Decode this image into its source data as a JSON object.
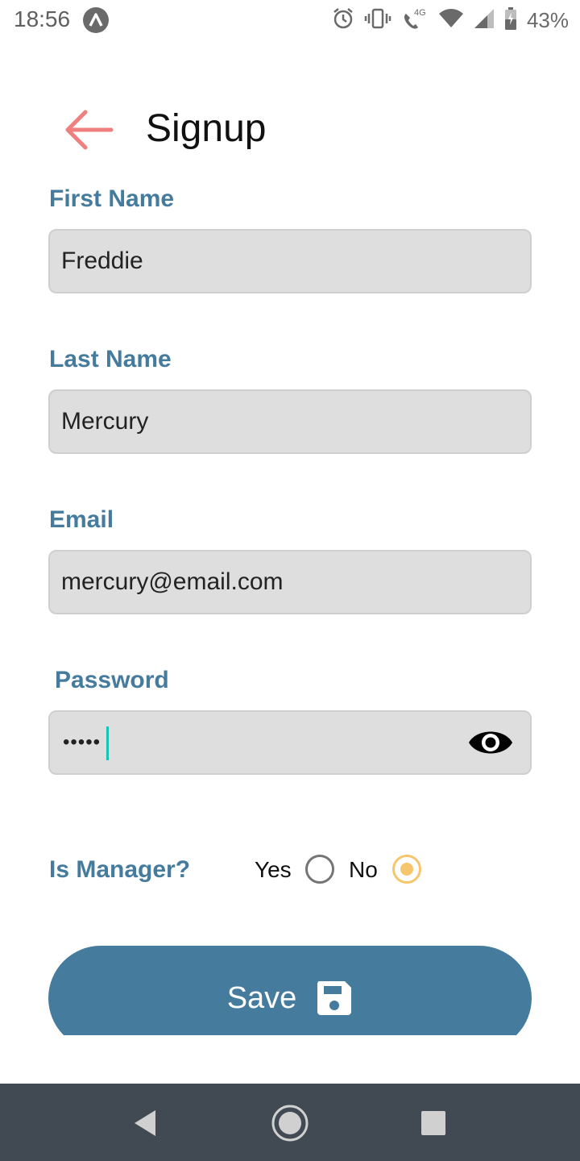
{
  "status_bar": {
    "time": "18:56",
    "app_icon": "lambda-icon",
    "icons": [
      "alarm-icon",
      "vibrate-icon",
      "wifi-calling-4g-icon",
      "wifi-icon",
      "cell-signal-icon",
      "battery-icon"
    ],
    "network_label": "4G",
    "battery_percent": "43%"
  },
  "header": {
    "back_icon": "arrow-left-icon",
    "title": "Signup"
  },
  "form": {
    "first_name": {
      "label": "First Name",
      "value": "Freddie"
    },
    "last_name": {
      "label": "Last Name",
      "value": "Mercury"
    },
    "email": {
      "label": "Email",
      "value": "mercury@email.com"
    },
    "password": {
      "label": "Password",
      "masked_value": "•••••",
      "toggle_icon": "eye-icon"
    },
    "is_manager": {
      "label": "Is Manager?",
      "options": [
        "Yes",
        "No"
      ],
      "selected": "No"
    },
    "save": {
      "label": "Save",
      "icon": "floppy-disk-icon"
    }
  },
  "nav_bar": {
    "icons": [
      "back-triangle-icon",
      "home-circle-icon",
      "recents-square-icon"
    ]
  },
  "colors": {
    "accent": "#457b9d",
    "back_arrow": "#f08080",
    "radio_selected": "#f5c66b",
    "field_bg": "#dedede",
    "nav_bg": "#414a52"
  }
}
